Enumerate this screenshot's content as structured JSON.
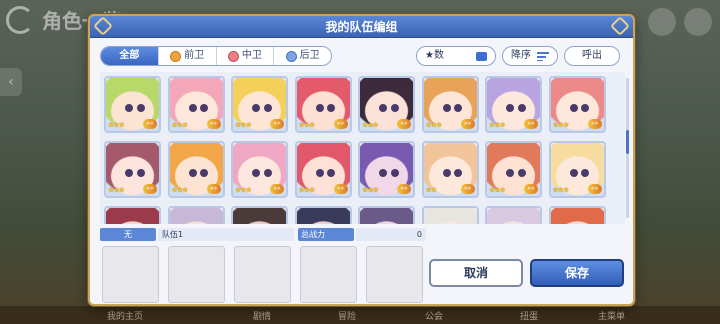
{
  "background": {
    "screen_title": "角色一览",
    "bottom_labels": [
      "我的主页",
      "剧情",
      "冒险",
      "公会",
      "扭蛋",
      "主菜单"
    ]
  },
  "dialog": {
    "title": "我的队伍编组"
  },
  "filters": {
    "tabs": [
      {
        "label": "全部",
        "icon": "",
        "active": true
      },
      {
        "label": "前卫",
        "icon": "front-role-icon",
        "active": false
      },
      {
        "label": "中卫",
        "icon": "middle-role-icon",
        "active": false
      },
      {
        "label": "后卫",
        "icon": "back-role-icon",
        "active": false
      }
    ],
    "sort_key_label": "★数",
    "sort_order_label": "降序",
    "call_label": "呼出"
  },
  "characters": [
    {
      "stars": "★★★",
      "rank": "»»",
      "hair": "#b9d86a",
      "skin": "#fbe4d2"
    },
    {
      "stars": "★★★",
      "rank": "»»",
      "hair": "#f3a7b9",
      "skin": "#fde6da"
    },
    {
      "stars": "★★★",
      "rank": "»»",
      "hair": "#f4d05a",
      "skin": "#fde6d6"
    },
    {
      "stars": "★★★",
      "rank": "»»",
      "hair": "#e35a6a",
      "skin": "#fde0d4"
    },
    {
      "stars": "★★★",
      "rank": "»»",
      "hair": "#3d2a3a",
      "skin": "#fbe2d8"
    },
    {
      "stars": "★★★",
      "rank": "»»",
      "hair": "#e8a25a",
      "skin": "#fde6d6"
    },
    {
      "stars": "★★★",
      "rank": "»»",
      "hair": "#b7a4e0",
      "skin": "#fde8de"
    },
    {
      "stars": "★★★",
      "rank": "»»",
      "hair": "#ec8a8a",
      "skin": "#fde6da"
    },
    {
      "stars": "★★★",
      "rank": "»»",
      "hair": "#a45a6a",
      "skin": "#fde4dc"
    },
    {
      "stars": "★★★",
      "rank": "»»",
      "hair": "#f2a648",
      "skin": "#fde4d2"
    },
    {
      "stars": "★★★",
      "rank": "»»",
      "hair": "#f0a7c4",
      "skin": "#fde6de"
    },
    {
      "stars": "★★★",
      "rank": "»»",
      "hair": "#e0586a",
      "skin": "#fde0d6"
    },
    {
      "stars": "★★★",
      "rank": "»»",
      "hair": "#7a5ab0",
      "skin": "#f0d8e8"
    },
    {
      "stars": "★★",
      "rank": "»»",
      "hair": "#f1c49a",
      "skin": "#fde8dc"
    },
    {
      "stars": "★★★",
      "rank": "»»",
      "hair": "#e07a5a",
      "skin": "#fde2d4"
    },
    {
      "stars": "★★★",
      "rank": "»»",
      "hair": "#f7dca0",
      "skin": "#fde8dc"
    },
    {
      "stars": "",
      "rank": "",
      "hair": "#9a3a4a",
      "skin": "#f4d8cc"
    },
    {
      "stars": "",
      "rank": "",
      "hair": "#c8b8d8",
      "skin": "#f4e0dc"
    },
    {
      "stars": "",
      "rank": "",
      "hair": "#4a3a3a",
      "skin": "#e8d0c4"
    },
    {
      "stars": "",
      "rank": "",
      "hair": "#3a3a5a",
      "skin": "#e8d4d0"
    },
    {
      "stars": "",
      "rank": "",
      "hair": "#6a5a8a",
      "skin": "#ecd8dc"
    },
    {
      "stars": "",
      "rank": "",
      "hair": "#e8e4e0",
      "skin": "#f4e8e0"
    },
    {
      "stars": "",
      "rank": "",
      "hair": "#d8c8e0",
      "skin": "#f4e4e4"
    },
    {
      "stars": "",
      "rank": "",
      "hair": "#e06a4a",
      "skin": "#f4dcd0"
    }
  ],
  "team": {
    "name_tag": "无",
    "name": "队伍1",
    "power_label": "总战力",
    "power_value": "0",
    "slot_count": 5
  },
  "buttons": {
    "cancel": "取消",
    "save": "保存"
  },
  "colors": {
    "accent_blue": "#3b63b3",
    "frame_gold": "#c9a45a",
    "star_gold": "#f3c12c"
  }
}
